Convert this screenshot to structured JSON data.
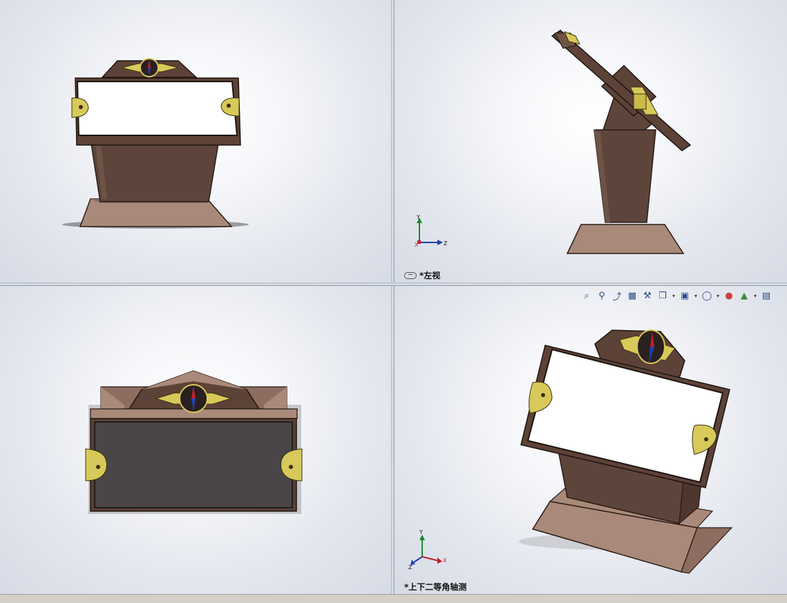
{
  "viewports": {
    "top_right_label": "*左视",
    "bottom_right_label": "*上下二等角轴测"
  },
  "triad_left": {
    "y": "Y",
    "x": "X",
    "z": "Z"
  },
  "triad_iso": {
    "y": "Y",
    "x": "X",
    "z": "Z"
  },
  "toolbar": {
    "items": [
      {
        "icon": "zoom-to-fit-icon"
      },
      {
        "icon": "zoom-to-area-icon"
      },
      {
        "icon": "previous-view-icon"
      },
      {
        "icon": "section-view-icon"
      },
      {
        "icon": "dynamic-annotation-icon"
      },
      {
        "icon": "view-orientation-icon",
        "dropdown": true
      },
      {
        "icon": "display-style-icon",
        "dropdown": true
      },
      {
        "icon": "hide-show-items-icon",
        "dropdown": true
      },
      {
        "icon": "edit-appearance-icon"
      },
      {
        "icon": "apply-scene-icon",
        "dropdown": true
      },
      {
        "icon": "view-settings-icon"
      }
    ]
  },
  "colors": {
    "wood_dark": "#5a4036",
    "wood_light": "#a78676",
    "brass": "#d7c95a",
    "panel_white": "#ffffff",
    "panel_dark": "#4a4546",
    "triad_y": "#1a8a2a",
    "triad_x": "#c0202a",
    "triad_z": "#1f3fb0"
  }
}
